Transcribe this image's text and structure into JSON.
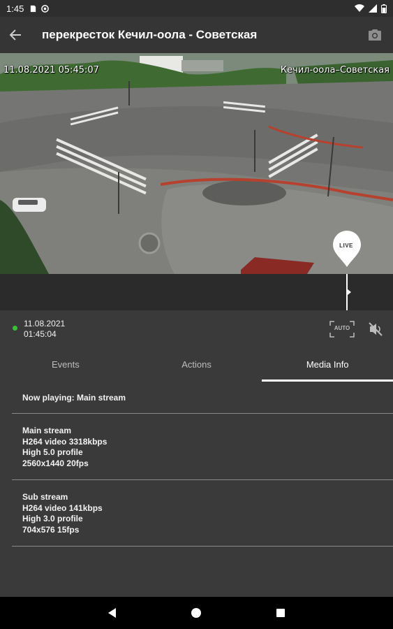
{
  "status_bar": {
    "time": "1:45",
    "icons_left": [
      "sim-card-icon",
      "at-sign-icon"
    ],
    "icons_right": [
      "wifi-icon",
      "signal-icon",
      "battery-icon"
    ]
  },
  "app_bar": {
    "title": "перекресток Кечил-оола - Советская",
    "back_icon": "arrow-back-icon",
    "action_icon": "camera-icon"
  },
  "video": {
    "osd_datetime": "11.08.2021 05:45:07",
    "osd_location": "Кечил-оола–Советская"
  },
  "timeline": {
    "live_label": "LIVE"
  },
  "info": {
    "date": "11.08.2021",
    "time": "01:45:04",
    "status_color": "#35c235",
    "auto_label": "AUTO",
    "mute_icon": "volume-off-icon"
  },
  "tabs": [
    {
      "label": "Events",
      "active": false
    },
    {
      "label": "Actions",
      "active": false
    },
    {
      "label": "Media Info",
      "active": true
    }
  ],
  "media_info": {
    "now_playing": "Now playing: Main stream",
    "main_stream": {
      "title": "Main stream",
      "codec": "H264 video 3318kbps",
      "profile": "High 5.0 profile",
      "resolution": "2560x1440 20fps"
    },
    "sub_stream": {
      "title": "Sub stream",
      "codec": "H264 video 141kbps",
      "profile": "High 3.0 profile",
      "resolution": "704x576 15fps"
    }
  },
  "nav_bar": {
    "buttons": [
      "back-triangle-icon",
      "home-circle-icon",
      "recents-square-icon"
    ]
  }
}
